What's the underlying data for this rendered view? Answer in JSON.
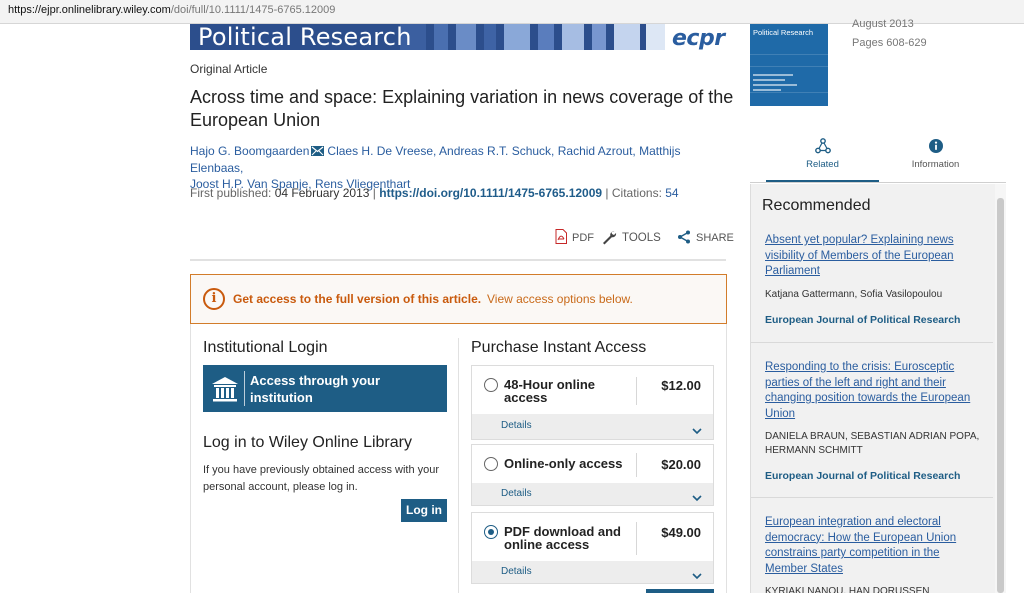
{
  "url": {
    "domain": "https://ejpr.onlinelibrary.wiley.com",
    "path": "/doi/full/10.1111/1475-6765.12009"
  },
  "journal": {
    "banner_title": "Political Research",
    "logo": "ecpr",
    "cover_title": "Political Research"
  },
  "issue": {
    "date": "August 2013",
    "pages": "Pages 608-629"
  },
  "article": {
    "type": "Original Article",
    "title": "Across time and space: Explaining variation in news coverage of the European Union",
    "authors_line1_first": "Hajo G. Boomgaarden",
    "authors_line1_rest": "Claes H. De Vreese, Andreas R.T. Schuck, Rachid Azrout, Matthijs Elenbaas,",
    "authors_line2": "Joost H.P. Van Spanje, Rens Vliegenthart",
    "first_published_label": "First published:",
    "first_published_date": "04 February 2013",
    "doi": "https://doi.org/10.1111/1475-6765.12009",
    "citations_label": "Citations:",
    "citations": "54",
    "sep": "|"
  },
  "toolbar": {
    "pdf": "PDF",
    "tools": "TOOLS",
    "share": "SHARE"
  },
  "notice": {
    "strong": "Get access to the full version of this article.",
    "normal": "View access options below."
  },
  "institutional": {
    "heading": "Institutional Login",
    "button": "Access through your institution"
  },
  "wiley_login": {
    "heading": "Log in to Wiley Online Library",
    "desc": "If you have previously obtained access with your personal account, please log in.",
    "button": "Log in"
  },
  "purchase": {
    "heading": "Purchase Instant Access",
    "details_label": "Details",
    "options": [
      {
        "name": "48-Hour online access",
        "price": "$12.00",
        "selected": false
      },
      {
        "name": "Online-only access",
        "price": "$20.00",
        "selected": false
      },
      {
        "name": "PDF download and online access",
        "price": "$49.00",
        "selected": true
      }
    ]
  },
  "tabs": {
    "related": "Related",
    "information": "Information"
  },
  "recommended": {
    "heading": "Recommended",
    "items": [
      {
        "title": "Absent yet popular? Explaining news visibility of Members of the European Parliament",
        "authors": "Katjana Gattermann, Sofia Vasilopoulou",
        "journal": "European Journal of Political Research"
      },
      {
        "title": "Responding to the crisis: Eurosceptic parties of the left and right and their changing position towards the European Union",
        "authors": "DANIELA BRAUN, SEBASTIAN ADRIAN POPA, HERMANN SCHMITT",
        "journal": "European Journal of Political Research"
      },
      {
        "title": "European integration and electoral democracy: How the European Union constrains party competition in the Member States",
        "authors": "KYRIAKI NANOU, HAN DORUSSEN",
        "journal": ""
      }
    ]
  },
  "colors": {
    "link": "#2a5d9f",
    "primary": "#1e5d85",
    "notice": "#c95a0d",
    "banner": "#2c4e8c"
  }
}
